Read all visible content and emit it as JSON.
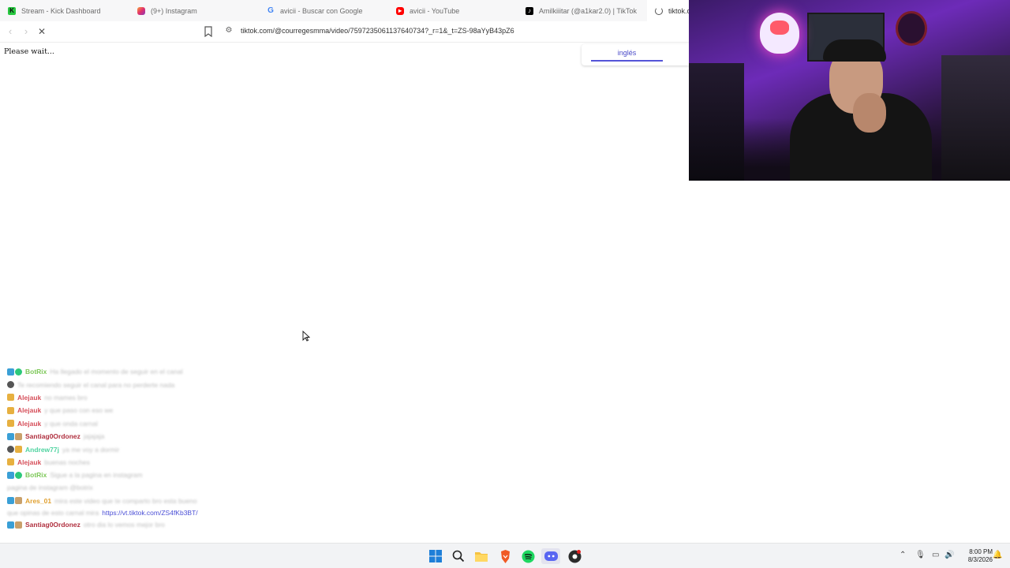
{
  "browser": {
    "tabs": [
      {
        "title": "Stream - Kick Dashboard",
        "icon": "kick-icon"
      },
      {
        "title": "(9+) Instagram",
        "icon": "instagram-icon"
      },
      {
        "title": "avicii - Buscar con Google",
        "icon": "google-icon"
      },
      {
        "title": "avicii - YouTube",
        "icon": "youtube-icon"
      },
      {
        "title": "Amilkiiitar (@a1kar2.0) | TikTok",
        "icon": "tiktok-icon"
      },
      {
        "title": "tiktok.co",
        "icon": "loading-spinner-icon"
      }
    ],
    "url": "tiktok.com/@courregesmma/video/7597235061137640734?_r=1&_t=ZS-98aYyB43pZ6"
  },
  "page": {
    "status_text": "Please wait...",
    "translate_language": "inglés"
  },
  "chat": {
    "messages": [
      {
        "user": "BotRix",
        "user_color": "#7ec85a",
        "badges": [
          "mod",
          "verified"
        ],
        "text": "Ha llegado el momento de seguir en el canal"
      },
      {
        "user": "",
        "user_color": "#999999",
        "badges": [
          "glasses"
        ],
        "text": "Te recomiendo seguir el canal para no perderte nada"
      },
      {
        "user": "Alejauk",
        "user_color": "#d64f5a",
        "badges": [
          "sub"
        ],
        "text": "no mames bro"
      },
      {
        "user": "Alejauk",
        "user_color": "#d64f5a",
        "badges": [
          "sub"
        ],
        "text": "y que paso con eso we"
      },
      {
        "user": "Alejauk",
        "user_color": "#d64f5a",
        "badges": [
          "sub"
        ],
        "text": "y que onda carnal"
      },
      {
        "user": "Santiag0Ordonez",
        "user_color": "#b0303f",
        "badges": [
          "mod",
          "vip"
        ],
        "text": "jajajaja"
      },
      {
        "user": "Andrew77j",
        "user_color": "#4fd3a0",
        "badges": [
          "glasses",
          "sub"
        ],
        "text": "ya me voy a dormir"
      },
      {
        "user": "Alejauk",
        "user_color": "#d64f5a",
        "badges": [
          "sub"
        ],
        "text": "buenas noches"
      },
      {
        "user": "BotRix",
        "user_color": "#7ec85a",
        "badges": [
          "mod",
          "verified"
        ],
        "text": "Sigue a la pagina en instagram",
        "extra": "pagina de instagram @botrix"
      },
      {
        "user": "Ares_01",
        "user_color": "#e0a030",
        "badges": [
          "mod",
          "vip"
        ],
        "text": "mira este video que te comparto bro esta bueno",
        "extra_text": "que opinas de esto carnal mira",
        "link": "https://vt.tiktok.com/ZS4fKb3BT/"
      },
      {
        "user": "Santiag0Ordonez",
        "user_color": "#b0303f",
        "badges": [
          "mod",
          "vip"
        ],
        "text": "otro dia lo vemos mejor bro"
      }
    ]
  },
  "taskbar": {
    "apps": [
      "windows-start-icon",
      "search-icon",
      "file-explorer-icon",
      "brave-browser-icon",
      "spotify-icon",
      "discord-icon",
      "obs-icon"
    ],
    "time": "8:00 PM",
    "date": "8/3/2026"
  },
  "colors": {
    "accent": "#5454d8",
    "link": "#4b4fd6",
    "webcam_purple": "#6d2bb8"
  }
}
